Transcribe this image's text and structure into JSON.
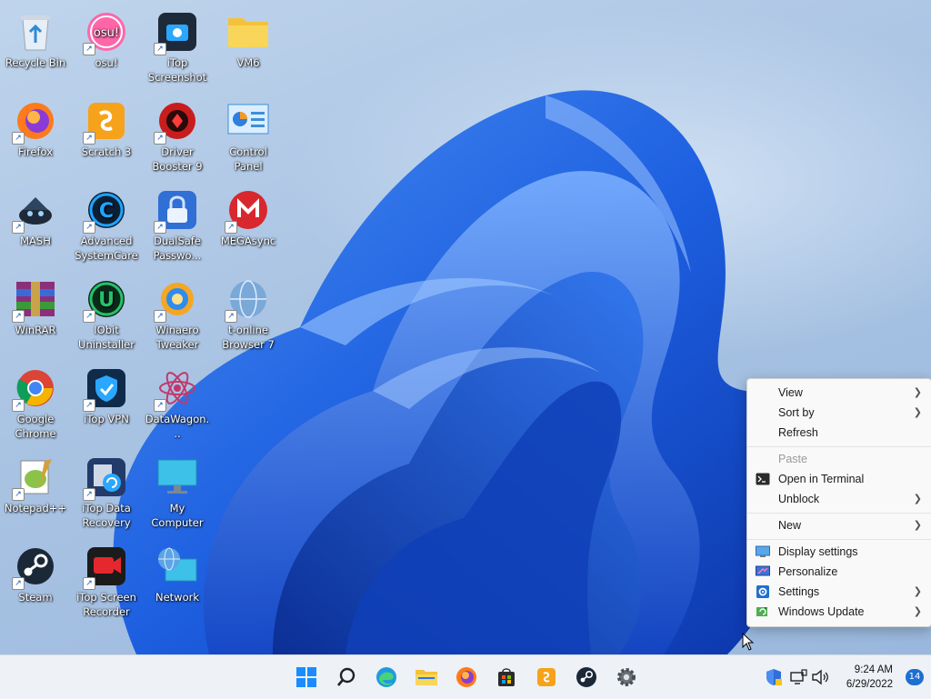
{
  "desktop_icons": [
    {
      "id": "recycle-bin",
      "label": "Recycle Bin",
      "icon": "recycle-bin-icon",
      "shortcut": false
    },
    {
      "id": "osu",
      "label": "osu!",
      "icon": "osu-icon",
      "shortcut": true
    },
    {
      "id": "itop-screenshot",
      "label": "iTop Screenshot",
      "icon": "camera-icon",
      "shortcut": true
    },
    {
      "id": "vm6",
      "label": "VM6",
      "icon": "folder-icon",
      "shortcut": false
    },
    {
      "id": "firefox",
      "label": "Firefox",
      "icon": "firefox-icon",
      "shortcut": true
    },
    {
      "id": "scratch3",
      "label": "Scratch 3",
      "icon": "scratch-icon",
      "shortcut": true
    },
    {
      "id": "driver-booster",
      "label": "Driver Booster 9",
      "icon": "driver-booster-icon",
      "shortcut": true
    },
    {
      "id": "control-panel",
      "label": "Control Panel",
      "icon": "control-panel-icon",
      "shortcut": false
    },
    {
      "id": "mash",
      "label": "MASH",
      "icon": "mash-icon",
      "shortcut": true
    },
    {
      "id": "advanced-systemcare",
      "label": "Advanced SystemCare",
      "icon": "systemcare-icon",
      "shortcut": true
    },
    {
      "id": "dualsafe",
      "label": "DualSafe Passwo...",
      "icon": "lock-icon",
      "shortcut": true
    },
    {
      "id": "megasync",
      "label": "MEGAsync",
      "icon": "mega-icon",
      "shortcut": true
    },
    {
      "id": "winrar",
      "label": "WinRAR",
      "icon": "winrar-icon",
      "shortcut": true
    },
    {
      "id": "iobit-uninstaller",
      "label": "IObit Uninstaller",
      "icon": "uninstaller-icon",
      "shortcut": true
    },
    {
      "id": "winaero",
      "label": "Winaero Tweaker",
      "icon": "winaero-icon",
      "shortcut": true
    },
    {
      "id": "t-online",
      "label": "t-online Browser 7",
      "icon": "globe-icon",
      "shortcut": true
    },
    {
      "id": "chrome",
      "label": "Google Chrome",
      "icon": "chrome-icon",
      "shortcut": true
    },
    {
      "id": "itop-vpn",
      "label": "iTop VPN",
      "icon": "vpn-icon",
      "shortcut": true
    },
    {
      "id": "datawagon",
      "label": "DataWagon...",
      "icon": "atom-icon",
      "shortcut": true
    },
    {
      "id": "notepadpp",
      "label": "Notepad++",
      "icon": "notepadpp-icon",
      "shortcut": true
    },
    {
      "id": "itop-data-recovery",
      "label": "iTop Data Recovery",
      "icon": "data-recovery-icon",
      "shortcut": true
    },
    {
      "id": "my-computer",
      "label": "My Computer",
      "icon": "monitor-icon",
      "shortcut": false
    },
    {
      "id": "steam",
      "label": "Steam",
      "icon": "steam-icon",
      "shortcut": true
    },
    {
      "id": "itop-screen-recorder",
      "label": "iTop Screen Recorder",
      "icon": "screen-recorder-icon",
      "shortcut": true
    },
    {
      "id": "network",
      "label": "Network",
      "icon": "network-icon",
      "shortcut": false
    }
  ],
  "context_menu": {
    "view": "View",
    "sort_by": "Sort by",
    "refresh": "Refresh",
    "paste": "Paste",
    "open_terminal": "Open in Terminal",
    "unblock": "Unblock",
    "new": "New",
    "display_settings": "Display settings",
    "personalize": "Personalize",
    "settings": "Settings",
    "windows_update": "Windows Update"
  },
  "taskbar": {
    "apps": [
      "start-icon",
      "search-icon",
      "edge-icon",
      "file-explorer-icon",
      "firefox-icon",
      "store-icon",
      "scratch-icon",
      "steam-icon",
      "settings-gear-icon"
    ],
    "time": "9:24 AM",
    "date": "6/29/2022",
    "notification_count": "14"
  },
  "colors": {
    "accent": "#0067c0",
    "wallpaper_blue": "#1f5fd6",
    "menu_bg": "#f9f9f9",
    "taskbar_bg": "#eef1f6"
  }
}
